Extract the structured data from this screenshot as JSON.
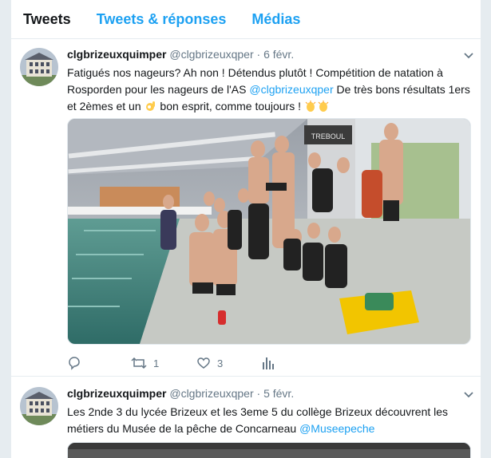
{
  "tabs": [
    {
      "label": "Tweets",
      "active": true
    },
    {
      "label": "Tweets & réponses",
      "active": false
    },
    {
      "label": "Médias",
      "active": false
    }
  ],
  "tweets": [
    {
      "name": "clgbrizeuxquimper",
      "handle": "@clgbrizeuxqper",
      "separator": "·",
      "date": "6 févr.",
      "text_1": "Fatigués nos nageurs? Ah non ! Détendus plutôt ! Compétition de natation à Rosporden pour les nageurs de l'AS ",
      "mention": "@clgbrizeuxqper",
      "text_2": "  De très bons résultats 1ers et 2èmes et un ",
      "text_3": " bon esprit, comme toujours ! ",
      "replies": "",
      "retweets": "1",
      "likes": "3",
      "media_sign": "TREBOUL"
    },
    {
      "name": "clgbrizeuxquimper",
      "handle": "@clgbrizeuxqper",
      "separator": "·",
      "date": "5 févr.",
      "text_1": "Les 2nde 3 du lycée Brizeux et les 3eme 5 du collège Brizeux découvrent les métiers du Musée de la pêche de Concarneau ",
      "mention": "@Museepeche"
    }
  ],
  "colors": {
    "accent": "#1da1f2",
    "muted": "#657786",
    "text": "#14171a"
  }
}
